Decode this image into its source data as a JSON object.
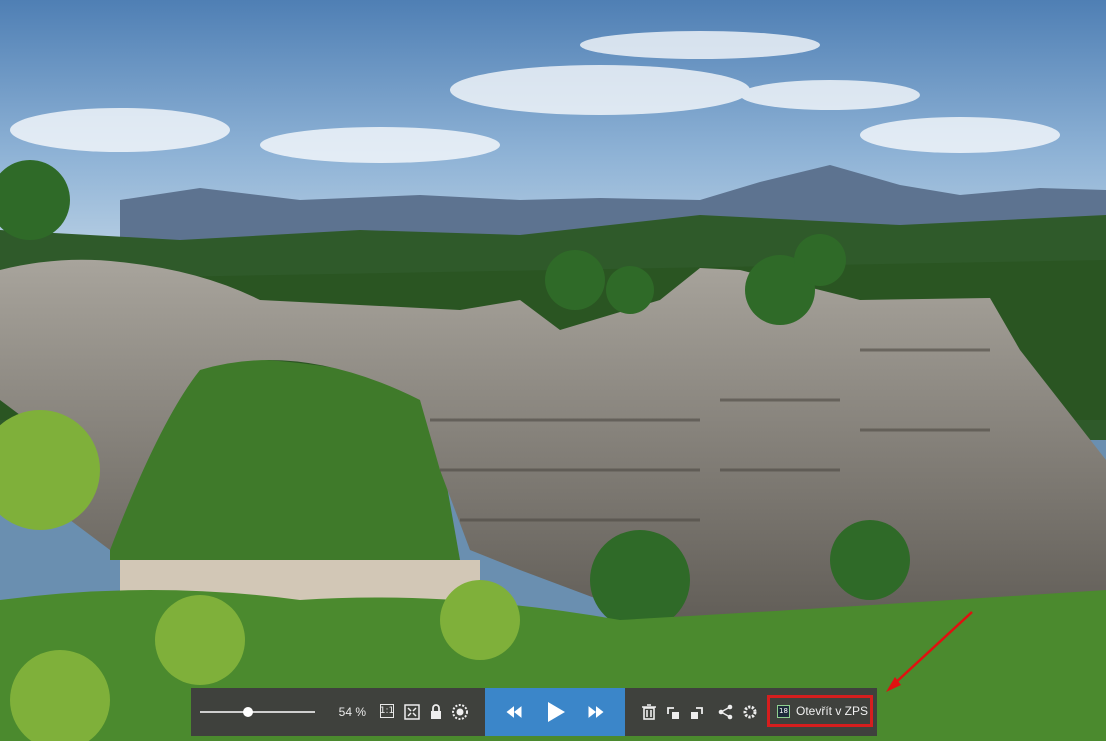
{
  "viewer": {
    "photo_description_icon": "landscape-photo",
    "toolbar": {
      "zoom_value": "54 %",
      "zoom_fraction": 0.42,
      "actual_size_label": "1:1",
      "open_in_zps_label": "Otevřít v ZPS",
      "icons": {
        "fit": "fullscreen-fit-icon",
        "lock": "lock-icon",
        "color": "color-wheel-icon",
        "prev": "previous-icon",
        "play": "play-icon",
        "next": "next-icon",
        "delete": "trash-icon",
        "rotate_left": "rotate-left-icon",
        "rotate_right": "rotate-right-icon",
        "share": "share-icon",
        "settings": "gear-icon",
        "zps_logo": "zps-logo-icon"
      }
    },
    "colors": {
      "toolbar_bg": "#3e3e3e",
      "nav_accent": "#3b86c9",
      "highlight": "#d61e1e"
    }
  }
}
